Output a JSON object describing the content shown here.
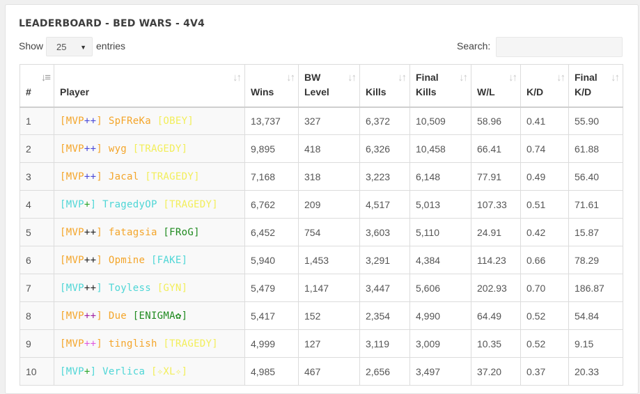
{
  "title": "LEADERBOARD - BED WARS - 4V4",
  "controls": {
    "show_label": "Show",
    "entries_value": "25",
    "entries_label": "entries",
    "search_label": "Search:",
    "search_value": ""
  },
  "columns": [
    "#",
    "Player",
    "Wins",
    "BW Level",
    "Kills",
    "Final Kills",
    "W/L",
    "K/D",
    "Final K/D"
  ],
  "rows": [
    {
      "rank": "1",
      "player": [
        [
          "[MVP",
          "orange"
        ],
        [
          "++",
          "blue"
        ],
        [
          "] SpFReKa ",
          "orange"
        ],
        [
          "[OBEY]",
          "yellow"
        ]
      ],
      "wins": "13,737",
      "level": "327",
      "kills": "6,372",
      "finals": "10,509",
      "wl": "58.96",
      "kd": "0.41",
      "fkd": "55.90"
    },
    {
      "rank": "2",
      "player": [
        [
          "[MVP",
          "orange"
        ],
        [
          "++",
          "blue"
        ],
        [
          "] wyg ",
          "orange"
        ],
        [
          "[TRAGEDY]",
          "yellow"
        ]
      ],
      "wins": "9,895",
      "level": "418",
      "kills": "6,326",
      "finals": "10,458",
      "wl": "66.41",
      "kd": "0.74",
      "fkd": "61.88"
    },
    {
      "rank": "3",
      "player": [
        [
          "[MVP",
          "orange"
        ],
        [
          "++",
          "blue"
        ],
        [
          "] Jacal ",
          "orange"
        ],
        [
          "[TRAGEDY]",
          "yellow"
        ]
      ],
      "wins": "7,168",
      "level": "318",
      "kills": "3,223",
      "finals": "6,148",
      "wl": "77.91",
      "kd": "0.49",
      "fkd": "56.40"
    },
    {
      "rank": "4",
      "player": [
        [
          "[MVP",
          "aqua"
        ],
        [
          "+",
          "green"
        ],
        [
          "] TragedyOP ",
          "aqua"
        ],
        [
          "[TRAGEDY]",
          "yellow"
        ]
      ],
      "wins": "6,762",
      "level": "209",
      "kills": "4,517",
      "finals": "5,013",
      "wl": "107.33",
      "kd": "0.51",
      "fkd": "71.61"
    },
    {
      "rank": "5",
      "player": [
        [
          "[MVP",
          "orange"
        ],
        [
          "++",
          "black"
        ],
        [
          "] fatagsia ",
          "orange"
        ],
        [
          "[FRoG]",
          "dkgreen"
        ]
      ],
      "wins": "6,452",
      "level": "754",
      "kills": "3,603",
      "finals": "5,110",
      "wl": "24.91",
      "kd": "0.42",
      "fkd": "15.87"
    },
    {
      "rank": "6",
      "player": [
        [
          "[MVP",
          "orange"
        ],
        [
          "++",
          "black"
        ],
        [
          "] Opmine ",
          "orange"
        ],
        [
          "[FAKE]",
          "aqua"
        ]
      ],
      "wins": "5,940",
      "level": "1,453",
      "kills": "3,291",
      "finals": "4,384",
      "wl": "114.23",
      "kd": "0.66",
      "fkd": "78.29"
    },
    {
      "rank": "7",
      "player": [
        [
          "[MVP",
          "aqua"
        ],
        [
          "++",
          "black"
        ],
        [
          "] Toyless ",
          "aqua"
        ],
        [
          "[GYN]",
          "yellow"
        ]
      ],
      "wins": "5,479",
      "level": "1,147",
      "kills": "3,447",
      "finals": "5,606",
      "wl": "202.93",
      "kd": "0.70",
      "fkd": "186.87"
    },
    {
      "rank": "8",
      "player": [
        [
          "[MVP",
          "orange"
        ],
        [
          "++",
          "purple"
        ],
        [
          "] Due ",
          "orange"
        ],
        [
          "[ENIGMA✿]",
          "dkgreen"
        ]
      ],
      "wins": "5,417",
      "level": "152",
      "kills": "2,354",
      "finals": "4,990",
      "wl": "64.49",
      "kd": "0.52",
      "fkd": "54.84"
    },
    {
      "rank": "9",
      "player": [
        [
          "[MVP",
          "orange"
        ],
        [
          "++",
          "pink"
        ],
        [
          "] tinglish ",
          "orange"
        ],
        [
          "[TRAGEDY]",
          "yellow"
        ]
      ],
      "wins": "4,999",
      "level": "127",
      "kills": "3,119",
      "finals": "3,009",
      "wl": "10.35",
      "kd": "0.52",
      "fkd": "9.15"
    },
    {
      "rank": "10",
      "player": [
        [
          "[MVP",
          "aqua"
        ],
        [
          "+",
          "green"
        ],
        [
          "] Verlica ",
          "aqua"
        ],
        [
          "[✧XL✧]",
          "yellow"
        ]
      ],
      "wins": "4,985",
      "level": "467",
      "kills": "2,656",
      "finals": "3,497",
      "wl": "37.20",
      "kd": "0.37",
      "fkd": "20.33"
    }
  ],
  "icons": {
    "sort_rank": "sort-numeric-icon",
    "sort_other": "sort-both-icon",
    "select_caret": "caret-down-icon"
  },
  "colors": {
    "orange": "#f4a52a",
    "blue": "#4a4ad8",
    "aqua": "#4ed6d6",
    "yellow": "#f2ee5a",
    "green": "#2aa52a",
    "dkgreen": "#1f8a1f",
    "pink": "#e05ae0",
    "purple": "#a020a0",
    "black": "#222222"
  }
}
